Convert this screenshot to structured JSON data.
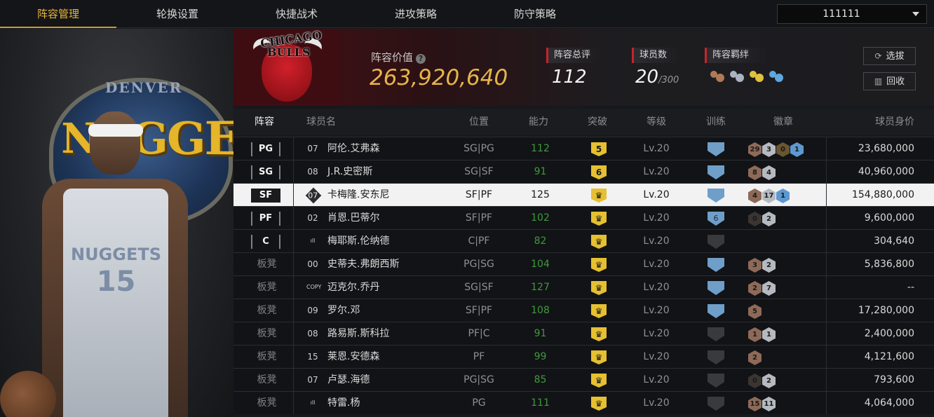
{
  "nav": {
    "tabs": [
      "阵容管理",
      "轮换设置",
      "快捷战术",
      "进攻策略",
      "防守策略"
    ],
    "active": 0,
    "dropdown_value": "111111"
  },
  "portrait": {
    "logo_text": "NUGGETS",
    "logo_sub": "DENVER",
    "jersey_name": "NUGGETS",
    "jersey_number": "15"
  },
  "header": {
    "team_logo_line1": "CHICAGO",
    "team_logo_line2": "BULLS",
    "value_label": "阵容价值",
    "value": "263,920,640",
    "rating_label": "阵容总评",
    "rating": "112",
    "players_label": "球员数",
    "players": "20",
    "players_max": "/300",
    "synergy_label": "阵容羁绊",
    "synergy_icons": [
      {
        "icon": "bronze-group-icon",
        "color": "#b07a55"
      },
      {
        "icon": "silver-group-icon",
        "color": "#a9b3c2"
      },
      {
        "icon": "gold-group-icon",
        "color": "#e2c23a"
      },
      {
        "icon": "blue-group-icon",
        "color": "#5ea7e0"
      }
    ],
    "select_button": "选拔",
    "recycle_button": "回收"
  },
  "table": {
    "columns": [
      "阵容",
      "球员名",
      "位置",
      "能力",
      "突破",
      "等级",
      "训练",
      "徽章",
      "球员身价"
    ],
    "rows": [
      {
        "slot": "PG",
        "num": "07",
        "num_style": "plain",
        "name": "阿伦.艾弗森",
        "pos": "SG|PG",
        "ability": "112",
        "break": "5",
        "level": "Lv.20",
        "train": "",
        "train_color": "#6f9ec9",
        "badges": [
          {
            "t": "29",
            "c": "#8d6a58"
          },
          {
            "t": "3",
            "c": "#b5b9c0"
          },
          {
            "t": "0",
            "c": "#6a5530"
          },
          {
            "t": "1",
            "c": "#5e98d0"
          }
        ],
        "value": "23,680,000"
      },
      {
        "slot": "SG",
        "num": "08",
        "num_style": "plain",
        "name": "J.R.史密斯",
        "pos": "SG|SF",
        "ability": "91",
        "break": "6",
        "level": "Lv.20",
        "train": "",
        "train_color": "#6f9ec9",
        "badges": [
          {
            "t": "8",
            "c": "#8d6a58"
          },
          {
            "t": "4",
            "c": "#b5b9c0"
          }
        ],
        "value": "40,960,000"
      },
      {
        "slot": "SF",
        "num": "07",
        "num_style": "diamond",
        "name": "卡梅隆.安东尼",
        "pos": "SF|PF",
        "ability": "125",
        "break": "♛",
        "level": "Lv.20",
        "train": "",
        "train_color": "#6f9ec9",
        "badges": [
          {
            "t": "4",
            "c": "#8d6a58"
          },
          {
            "t": "17",
            "c": "#b5b9c0"
          },
          {
            "t": "1",
            "c": "#5e98d0"
          }
        ],
        "value": "154,880,000"
      },
      {
        "slot": "PF",
        "num": "02",
        "num_style": "plain",
        "name": "肖恩.巴蒂尔",
        "pos": "SF|PF",
        "ability": "102",
        "break": "♛",
        "level": "Lv.20",
        "train": "6",
        "train_color": "#6f9ec9",
        "badges": [
          {
            "t": "0",
            "c": "#3a3530"
          },
          {
            "t": "2",
            "c": "#b5b9c0"
          }
        ],
        "value": "9,600,000"
      },
      {
        "slot": "C",
        "num": "ıll",
        "num_style": "plain",
        "name": "梅耶斯.伦纳德",
        "pos": "C|PF",
        "ability": "82",
        "break": "♛",
        "level": "Lv.20",
        "train": "",
        "train_color": "#3a3a3d",
        "badges": [],
        "value": "304,640"
      },
      {
        "slot": "板凳",
        "num": "00",
        "num_style": "plain",
        "name": "史蒂夫.弗朗西斯",
        "pos": "PG|SG",
        "ability": "104",
        "break": "♛",
        "level": "Lv.20",
        "train": "",
        "train_color": "#6f9ec9",
        "badges": [
          {
            "t": "3",
            "c": "#8d6a58"
          },
          {
            "t": "2",
            "c": "#b5b9c0"
          }
        ],
        "value": "5,836,800"
      },
      {
        "slot": "板凳",
        "num": "COPY",
        "num_style": "plain",
        "name": "迈克尔.乔丹",
        "pos": "SG|SF",
        "ability": "127",
        "break": "♛",
        "level": "Lv.20",
        "train": "",
        "train_color": "#6f9ec9",
        "badges": [
          {
            "t": "2",
            "c": "#8d6a58"
          },
          {
            "t": "7",
            "c": "#b5b9c0"
          }
        ],
        "value": "--"
      },
      {
        "slot": "板凳",
        "num": "09",
        "num_style": "plain",
        "name": "罗尔.邓",
        "pos": "SF|PF",
        "ability": "108",
        "break": "♛",
        "level": "Lv.20",
        "train": "",
        "train_color": "#6f9ec9",
        "badges": [
          {
            "t": "5",
            "c": "#8d6a58"
          }
        ],
        "value": "17,280,000"
      },
      {
        "slot": "板凳",
        "num": "08",
        "num_style": "plain",
        "name": "路易斯.斯科拉",
        "pos": "PF|C",
        "ability": "91",
        "break": "♛",
        "level": "Lv.20",
        "train": "",
        "train_color": "#3a3a3d",
        "badges": [
          {
            "t": "1",
            "c": "#8d6a58"
          },
          {
            "t": "1",
            "c": "#b5b9c0"
          }
        ],
        "value": "2,400,000"
      },
      {
        "slot": "板凳",
        "num": "15",
        "num_style": "plain",
        "name": "莱恩.安德森",
        "pos": "PF",
        "ability": "99",
        "break": "♛",
        "level": "Lv.20",
        "train": "",
        "train_color": "#3a3a3d",
        "badges": [
          {
            "t": "2",
            "c": "#8d6a58"
          }
        ],
        "value": "4,121,600"
      },
      {
        "slot": "板凳",
        "num": "07",
        "num_style": "plain",
        "name": "卢瑟.海德",
        "pos": "PG|SG",
        "ability": "85",
        "break": "♛",
        "level": "Lv.20",
        "train": "",
        "train_color": "#3a3a3d",
        "badges": [
          {
            "t": "0",
            "c": "#3a3530"
          },
          {
            "t": "2",
            "c": "#b5b9c0"
          }
        ],
        "value": "793,600"
      },
      {
        "slot": "板凳",
        "num": "ıll",
        "num_style": "plain",
        "name": "特雷.杨",
        "pos": "PG",
        "ability": "111",
        "break": "♛",
        "level": "Lv.20",
        "train": "",
        "train_color": "#3a3a3d",
        "badges": [
          {
            "t": "15",
            "c": "#8d6a58"
          },
          {
            "t": "11",
            "c": "#b5b9c0"
          }
        ],
        "value": "4,064,000"
      }
    ],
    "selected_row": 2
  }
}
